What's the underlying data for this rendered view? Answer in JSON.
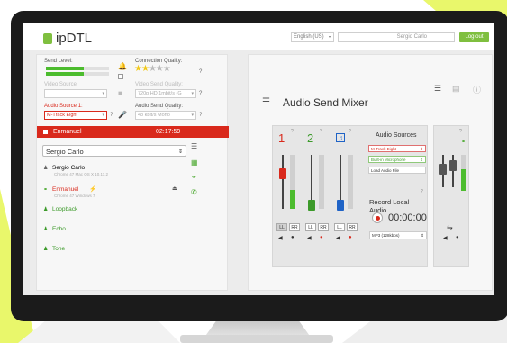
{
  "app": {
    "logo_text": "ipDTL",
    "language": "English (US)",
    "user": "Sergio Carlo",
    "logout_label": "Log out"
  },
  "left": {
    "send_level_label": "Send Level:",
    "send_level_fraction": 0.6,
    "connection_quality_label": "Connection Quality:",
    "connection_stars_on": 2,
    "connection_stars_total": 5,
    "video_source_label": "Video Source:",
    "video_send_quality_label": "Video Send Quality:",
    "video_send_quality_value": "720p HD 1mbit/s (G",
    "audio_source_label": "Audio Source 1:",
    "audio_source_value": "M-Track Eight",
    "audio_send_quality_label": "Audio Send Quality:",
    "audio_send_quality_value": "48 kbit/s Mono",
    "help": "?",
    "active_call": {
      "name": "Enmanuel",
      "timer": "02:17:59"
    },
    "contact_select": "Sergio Carlo",
    "contacts": [
      {
        "name": "Sergio Carlo",
        "sub": "Chrome 47 Mac OS X 10.11.2",
        "color": "#555555"
      },
      {
        "name": "Enmanuel",
        "sub": "Chrome 47 Windows 7",
        "color": "#d9291c"
      },
      {
        "name": "Loopback",
        "sub": "",
        "color": "#3c9a2a"
      },
      {
        "name": "Echo",
        "sub": "",
        "color": "#3c9a2a"
      },
      {
        "name": "Tone",
        "sub": "",
        "color": "#3c9a2a"
      }
    ]
  },
  "right": {
    "title": "Audio Send Mixer",
    "channels": [
      {
        "number": "1",
        "color": "#d9291c",
        "level": 0.35
      },
      {
        "number": "2",
        "color": "#3c9a2a",
        "level": 0.0
      },
      {
        "number": "",
        "color": "#1f63c6",
        "level": 0.0
      }
    ],
    "btn_ll": "LL",
    "btn_rr": "RR",
    "audio_sources_title": "Audio Sources",
    "audio_sources": [
      "M-Track Eight",
      "Built-in Microphone",
      "Load Audio File"
    ],
    "record_title": "Record Local Audio",
    "record_time": "00:00:00",
    "record_format": "MP3 (128kbps)",
    "help": "?"
  },
  "colors": {
    "accent_green": "#7fbf3f",
    "red": "#d9291c",
    "meter_green": "#4cbc2e"
  }
}
